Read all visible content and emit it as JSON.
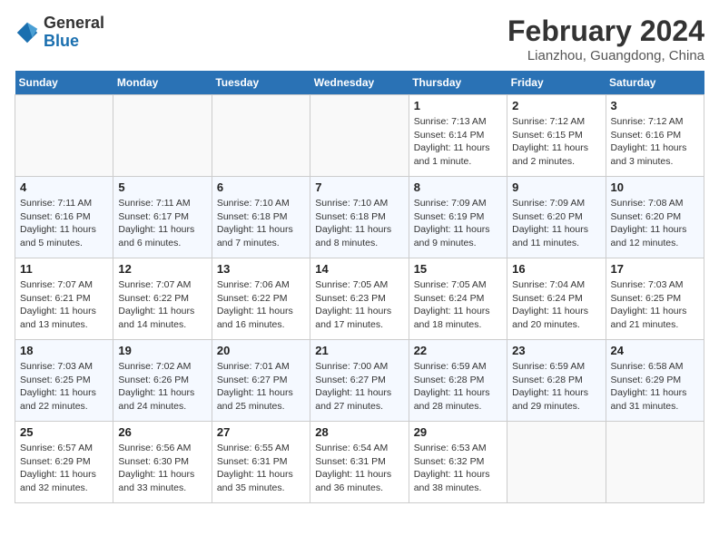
{
  "header": {
    "logo_general": "General",
    "logo_blue": "Blue",
    "month_title": "February 2024",
    "subtitle": "Lianzhou, Guangdong, China"
  },
  "weekdays": [
    "Sunday",
    "Monday",
    "Tuesday",
    "Wednesday",
    "Thursday",
    "Friday",
    "Saturday"
  ],
  "weeks": [
    [
      {
        "day": "",
        "info": ""
      },
      {
        "day": "",
        "info": ""
      },
      {
        "day": "",
        "info": ""
      },
      {
        "day": "",
        "info": ""
      },
      {
        "day": "1",
        "info": "Sunrise: 7:13 AM\nSunset: 6:14 PM\nDaylight: 11 hours and 1 minute."
      },
      {
        "day": "2",
        "info": "Sunrise: 7:12 AM\nSunset: 6:15 PM\nDaylight: 11 hours and 2 minutes."
      },
      {
        "day": "3",
        "info": "Sunrise: 7:12 AM\nSunset: 6:16 PM\nDaylight: 11 hours and 3 minutes."
      }
    ],
    [
      {
        "day": "4",
        "info": "Sunrise: 7:11 AM\nSunset: 6:16 PM\nDaylight: 11 hours and 5 minutes."
      },
      {
        "day": "5",
        "info": "Sunrise: 7:11 AM\nSunset: 6:17 PM\nDaylight: 11 hours and 6 minutes."
      },
      {
        "day": "6",
        "info": "Sunrise: 7:10 AM\nSunset: 6:18 PM\nDaylight: 11 hours and 7 minutes."
      },
      {
        "day": "7",
        "info": "Sunrise: 7:10 AM\nSunset: 6:18 PM\nDaylight: 11 hours and 8 minutes."
      },
      {
        "day": "8",
        "info": "Sunrise: 7:09 AM\nSunset: 6:19 PM\nDaylight: 11 hours and 9 minutes."
      },
      {
        "day": "9",
        "info": "Sunrise: 7:09 AM\nSunset: 6:20 PM\nDaylight: 11 hours and 11 minutes."
      },
      {
        "day": "10",
        "info": "Sunrise: 7:08 AM\nSunset: 6:20 PM\nDaylight: 11 hours and 12 minutes."
      }
    ],
    [
      {
        "day": "11",
        "info": "Sunrise: 7:07 AM\nSunset: 6:21 PM\nDaylight: 11 hours and 13 minutes."
      },
      {
        "day": "12",
        "info": "Sunrise: 7:07 AM\nSunset: 6:22 PM\nDaylight: 11 hours and 14 minutes."
      },
      {
        "day": "13",
        "info": "Sunrise: 7:06 AM\nSunset: 6:22 PM\nDaylight: 11 hours and 16 minutes."
      },
      {
        "day": "14",
        "info": "Sunrise: 7:05 AM\nSunset: 6:23 PM\nDaylight: 11 hours and 17 minutes."
      },
      {
        "day": "15",
        "info": "Sunrise: 7:05 AM\nSunset: 6:24 PM\nDaylight: 11 hours and 18 minutes."
      },
      {
        "day": "16",
        "info": "Sunrise: 7:04 AM\nSunset: 6:24 PM\nDaylight: 11 hours and 20 minutes."
      },
      {
        "day": "17",
        "info": "Sunrise: 7:03 AM\nSunset: 6:25 PM\nDaylight: 11 hours and 21 minutes."
      }
    ],
    [
      {
        "day": "18",
        "info": "Sunrise: 7:03 AM\nSunset: 6:25 PM\nDaylight: 11 hours and 22 minutes."
      },
      {
        "day": "19",
        "info": "Sunrise: 7:02 AM\nSunset: 6:26 PM\nDaylight: 11 hours and 24 minutes."
      },
      {
        "day": "20",
        "info": "Sunrise: 7:01 AM\nSunset: 6:27 PM\nDaylight: 11 hours and 25 minutes."
      },
      {
        "day": "21",
        "info": "Sunrise: 7:00 AM\nSunset: 6:27 PM\nDaylight: 11 hours and 27 minutes."
      },
      {
        "day": "22",
        "info": "Sunrise: 6:59 AM\nSunset: 6:28 PM\nDaylight: 11 hours and 28 minutes."
      },
      {
        "day": "23",
        "info": "Sunrise: 6:59 AM\nSunset: 6:28 PM\nDaylight: 11 hours and 29 minutes."
      },
      {
        "day": "24",
        "info": "Sunrise: 6:58 AM\nSunset: 6:29 PM\nDaylight: 11 hours and 31 minutes."
      }
    ],
    [
      {
        "day": "25",
        "info": "Sunrise: 6:57 AM\nSunset: 6:29 PM\nDaylight: 11 hours and 32 minutes."
      },
      {
        "day": "26",
        "info": "Sunrise: 6:56 AM\nSunset: 6:30 PM\nDaylight: 11 hours and 33 minutes."
      },
      {
        "day": "27",
        "info": "Sunrise: 6:55 AM\nSunset: 6:31 PM\nDaylight: 11 hours and 35 minutes."
      },
      {
        "day": "28",
        "info": "Sunrise: 6:54 AM\nSunset: 6:31 PM\nDaylight: 11 hours and 36 minutes."
      },
      {
        "day": "29",
        "info": "Sunrise: 6:53 AM\nSunset: 6:32 PM\nDaylight: 11 hours and 38 minutes."
      },
      {
        "day": "",
        "info": ""
      },
      {
        "day": "",
        "info": ""
      }
    ]
  ]
}
